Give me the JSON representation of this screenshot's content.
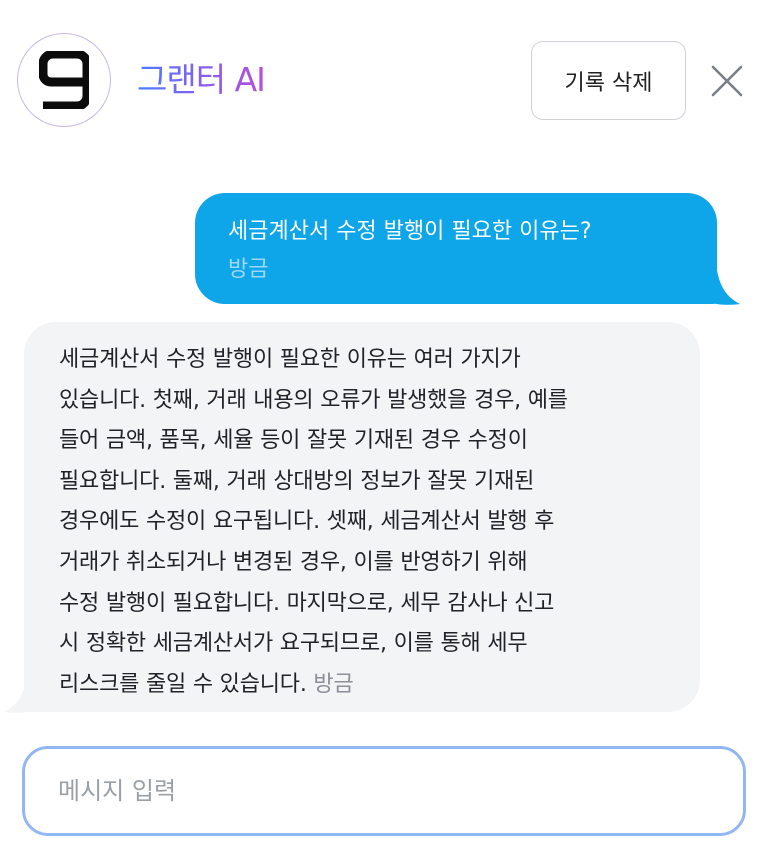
{
  "header": {
    "logo_icon": "grantter-g-logo-icon",
    "title": "그랜터 AI",
    "clear_history_label": "기록 삭제",
    "close_icon": "close-icon"
  },
  "colors": {
    "user_bubble": "#0ea5e9",
    "bot_bubble": "#f3f4f6",
    "title_gradient_start": "#4a7dff",
    "title_gradient_end": "#b84fd8",
    "input_border": "#93b7f5"
  },
  "messages": [
    {
      "role": "user",
      "text": "세금계산서 수정 발행이 필요한 이유는?",
      "time": "방금"
    },
    {
      "role": "assistant",
      "lines": [
        "세금계산서 수정 발행이 필요한 이유는 여러 가지가",
        "있습니다. 첫째, 거래 내용의 오류가 발생했을 경우, 예를",
        "들어 금액, 품목, 세율 등이 잘못 기재된 경우 수정이",
        "필요합니다. 둘째, 거래 상대방의 정보가 잘못 기재된",
        "경우에도 수정이 요구됩니다. 셋째, 세금계산서 발행 후",
        "거래가 취소되거나 변경된 경우, 이를 반영하기 위해",
        "수정 발행이 필요합니다. 마지막으로, 세무 감사나 신고",
        "시 정확한 세금계산서가 요구되므로, 이를 통해 세무",
        "리스크를 줄일 수 있습니다."
      ],
      "time": "방금"
    }
  ],
  "composer": {
    "placeholder": "메시지 입력",
    "value": ""
  }
}
